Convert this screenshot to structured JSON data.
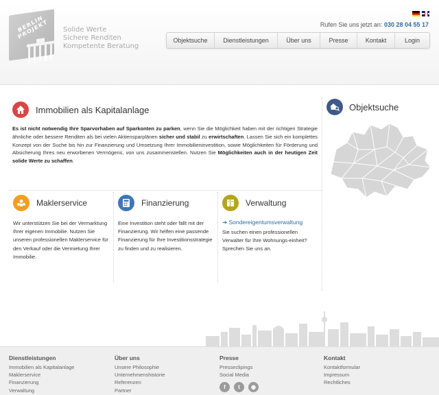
{
  "header": {
    "logo_text": "BERLIN PROJEKT",
    "tagline": [
      "Solide Werte",
      "Sichere Renditen",
      "Kompetente Beratung"
    ],
    "callus_label": "Rufen Sie uns jetzt an:",
    "phone": "030 28 04 55 17",
    "flags": [
      "de-flag-icon",
      "gb-flag-icon"
    ]
  },
  "nav": [
    "Objektsuche",
    "Dienstleistungen",
    "Über uns",
    "Presse",
    "Kontakt",
    "Login"
  ],
  "intro": {
    "title": "Immobilien als Kapitalanlage",
    "icon": "house-icon",
    "p1_bold": "Es ist nicht notwendig Ihre Sparvorhaben auf Sparkonten zu parken",
    "p1_a": ", wenn Sie die Möglichkeit haben mit der richtigen Strategie ähnliche oder bessere Renditen als bei vielen Aktiensparplänen ",
    "p1_bold2": "sicher und stabil",
    "p1_b": " zu ",
    "p1_bold3": "erwirtschaften",
    "p1_c": ". Lassen Sie sich ein komplettes Konzept von der Suche bis hin zur Finanzierung und Umsetzung Ihrer Immobilieninvestition, sowie Möglichkeiten für Förderung und Absicherung Ihres neu erworbenen Vermögens, von uns zusammenstellen. Nutzen Sie ",
    "p1_bold4": "Möglichkeiten auch in der heutigen Zeit solide Werte zu schaffen",
    "p1_d": "."
  },
  "columns": [
    {
      "title": "Maklerservice",
      "icon": "users-icon",
      "text": "Wir unterstützen Sie bei der Vermarktung Ihrer eigenen Immobilie. Nutzen Sie unseren professionellen Maklerservice für den Verkauf oder die Vermietung Ihrer Immobilie."
    },
    {
      "title": "Finanzierung",
      "icon": "calculator-icon",
      "text": "Eine Investition steht oder fällt mit der Finanzierung. Wir helfen eine passende Finanzierung für Ihre Investitionsstrategie zu finden und zu realisieren."
    },
    {
      "title": "Verwaltung",
      "icon": "folder-icon",
      "link": "Sondereigentumsverwaltung",
      "text": "Sie suchen einen professionellen Verwalter für Ihre Wohnungs-einheit? Sprechen Sie uns an."
    }
  ],
  "sidebar": {
    "title": "Objektsuche",
    "icon": "house-search-icon",
    "map": "berlin-map"
  },
  "footer": [
    {
      "title": "Dienstleistungen",
      "links": [
        "Immobilien als Kapitalanlage",
        "Maklerservice",
        "Finanzierung",
        "Verwaltung"
      ]
    },
    {
      "title": "Über uns",
      "links": [
        "Unsere Philosophie",
        "Unternehmenshistorie",
        "Referenzen",
        "Partner"
      ]
    },
    {
      "title": "Presse",
      "links": [
        "Presseclipings",
        "Social Media"
      ],
      "social": [
        "facebook-icon",
        "twitter-icon",
        "rss-icon"
      ]
    },
    {
      "title": "Kontakt",
      "links": [
        "Kontaktformular",
        "Impressum",
        "Rechtliches"
      ]
    }
  ],
  "colors": {
    "link": "#2e6da4",
    "icon_red": "#d94646",
    "icon_orange": "#f0a020",
    "icon_blue": "#3f75b3",
    "icon_olive": "#b3a51d",
    "icon_navy": "#3e5a86"
  }
}
